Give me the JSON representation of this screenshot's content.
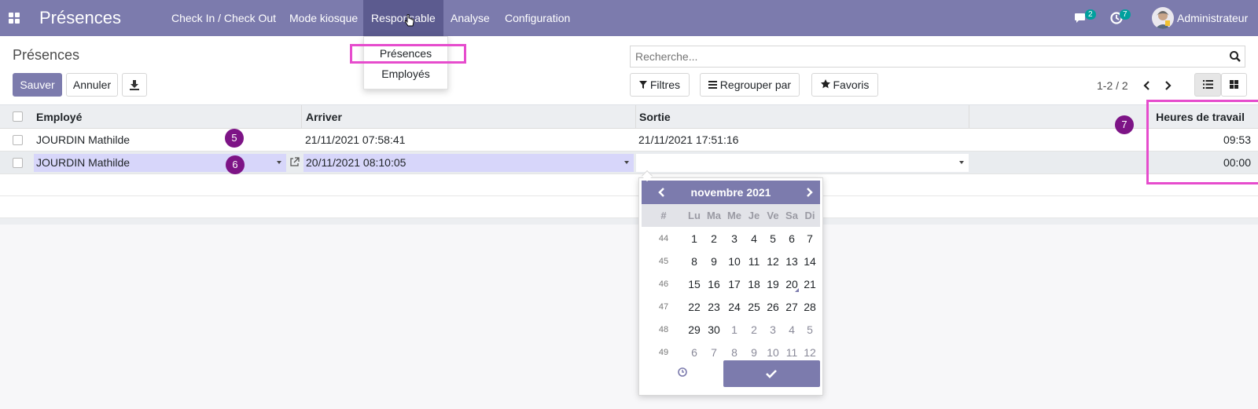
{
  "navbar": {
    "app_title": "Présences",
    "menu": [
      "Check In / Check Out",
      "Mode kiosque",
      "Responsable",
      "Analyse",
      "Configuration"
    ],
    "messages_count": "2",
    "activities_count": "7",
    "user": "Administrateur"
  },
  "dropdown": {
    "items": [
      "Présences",
      "Employés"
    ]
  },
  "control": {
    "breadcrumb": "Présences",
    "save": "Sauver",
    "discard": "Annuler",
    "search_placeholder": "Recherche...",
    "filters": "Filtres",
    "group_by": "Regrouper par",
    "favorites": "Favoris",
    "pager": "1-2 / 2"
  },
  "table": {
    "headers": [
      "Employé",
      "Arriver",
      "Sortie",
      "Heures de travail"
    ],
    "rows": [
      {
        "employee": "JOURDIN Mathilde",
        "check_in": "21/11/2021 07:58:41",
        "check_out": "21/11/2021 17:51:16",
        "hours": "09:53"
      },
      {
        "employee": "JOURDIN Mathilde",
        "check_in": "20/11/2021 08:10:05",
        "check_out": "",
        "hours": "00:00"
      }
    ]
  },
  "annotations": [
    "5",
    "6",
    "7"
  ],
  "datepicker": {
    "month": "novembre 2021",
    "week_header": "#",
    "days_of_week": [
      "Lu",
      "Ma",
      "Me",
      "Je",
      "Ve",
      "Sa",
      "Di"
    ],
    "weeks": [
      {
        "num": "44",
        "days": [
          "1",
          "2",
          "3",
          "4",
          "5",
          "6",
          "7"
        ]
      },
      {
        "num": "45",
        "days": [
          "8",
          "9",
          "10",
          "11",
          "12",
          "13",
          "14"
        ]
      },
      {
        "num": "46",
        "days": [
          "15",
          "16",
          "17",
          "18",
          "19",
          "20",
          "21"
        ]
      },
      {
        "num": "47",
        "days": [
          "22",
          "23",
          "24",
          "25",
          "26",
          "27",
          "28"
        ]
      },
      {
        "num": "48",
        "days": [
          "29",
          "30",
          "1",
          "2",
          "3",
          "4",
          "5"
        ]
      },
      {
        "num": "49",
        "days": [
          "6",
          "7",
          "8",
          "9",
          "10",
          "11",
          "12"
        ]
      }
    ]
  },
  "colors": {
    "brand": "#7c7bad",
    "highlight": "#e64ccd",
    "annotation": "#7d1486",
    "badge": "#00a09d"
  }
}
